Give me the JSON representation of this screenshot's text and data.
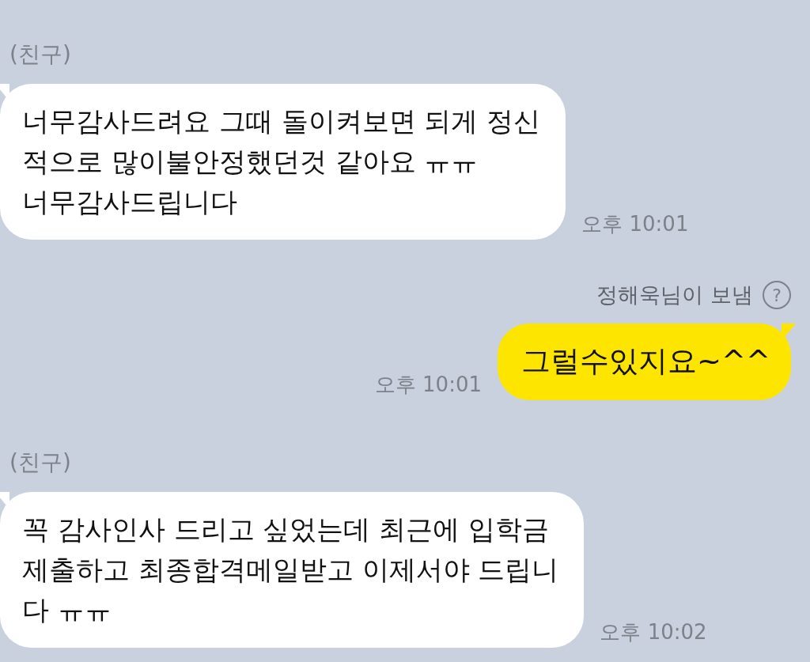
{
  "messages": [
    {
      "kind": "received",
      "sender": "(친구)",
      "lines": [
        "너무감사드려요 그때 돌이켜보면 되게 정신",
        "적으로 많이불안정했던것 같아요 ㅠㅠ",
        "너무감사드립니다"
      ],
      "time": "오후 10:01"
    },
    {
      "kind": "sent",
      "sender": "정해욱님이 보냄",
      "help": "?",
      "lines": [
        "그럴수있지요~^^"
      ],
      "time": "오후 10:01"
    },
    {
      "kind": "received",
      "sender": "(친구)",
      "lines": [
        "꼭 감사인사 드리고 싶었는데 최근에 입학금",
        "제출하고 최종합격메일받고 이제서야 드립니",
        "다 ㅠㅠ"
      ],
      "time": "오후 10:02"
    }
  ]
}
